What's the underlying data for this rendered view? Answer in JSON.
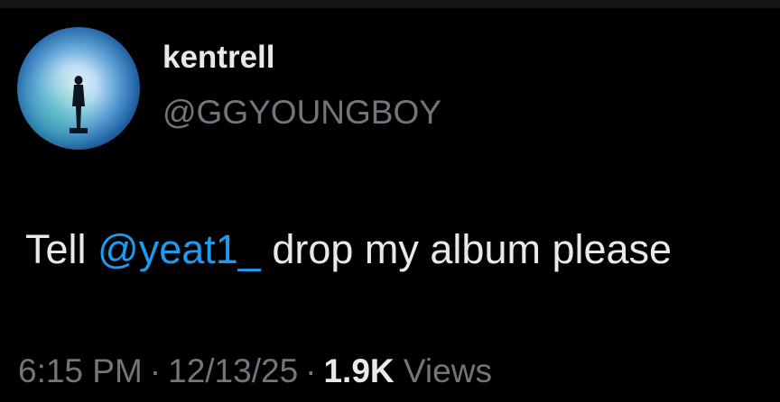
{
  "tweet": {
    "author": {
      "display_name": "kentrell",
      "handle": "@GGYOUNGBOY"
    },
    "text_before": "Tell ",
    "mention": "@yeat1_",
    "text_after": " drop my album please",
    "time": "6:15 PM",
    "separator": "·",
    "date": "12/13/25",
    "views_count": "1.9K",
    "views_label": "Views"
  },
  "colors": {
    "background": "#000000",
    "primary_text": "#e7e9ea",
    "secondary_text": "#71767b",
    "link": "#1d9bf0"
  },
  "icons": {
    "avatar": "profile-photo-silhouette-in-blue-smoke"
  }
}
